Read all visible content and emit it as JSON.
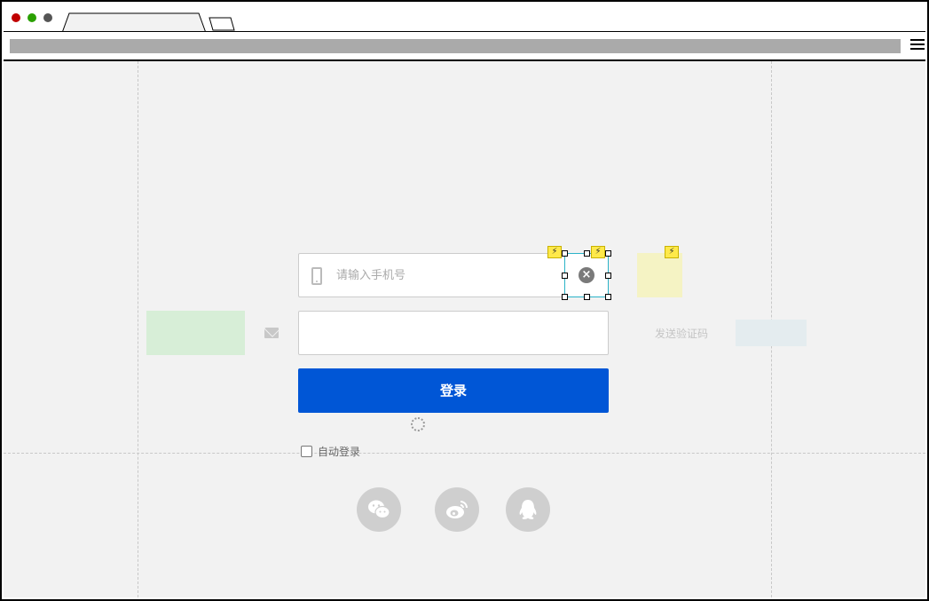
{
  "browser": {
    "traffic_lights": [
      "#c00000",
      "#2aa000",
      "#555555"
    ]
  },
  "form": {
    "phone_placeholder": "请输入手机号",
    "phone_value": "",
    "code_value": "",
    "send_code_label": "发送验证码",
    "login_label": "登录",
    "auto_login_label": "自动登录",
    "auto_login_checked": false
  },
  "clear_icon_glyph": "×",
  "bolt_glyph": "⚡",
  "social": [
    {
      "icon": "wechat-icon"
    },
    {
      "icon": "weibo-icon"
    },
    {
      "icon": "qq-icon"
    }
  ],
  "colors": {
    "primary": "#0056d6",
    "selection": "#2bb3c8",
    "badge": "#ffe94a"
  }
}
